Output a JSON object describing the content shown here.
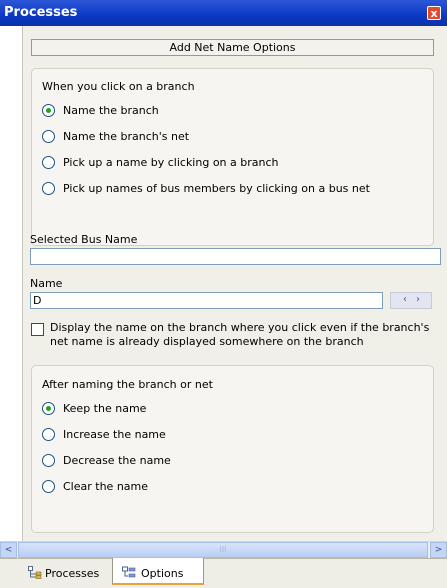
{
  "window": {
    "title": "Processes",
    "close_glyph": "x"
  },
  "options_header": "Add Net Name Options",
  "click_group": {
    "title": "When you click on a branch",
    "options": [
      {
        "label": "Name the branch",
        "selected": true
      },
      {
        "label": "Name the branch's net",
        "selected": false
      },
      {
        "label": "Pick up a name by clicking on a branch",
        "selected": false
      },
      {
        "label": "Pick up names of bus members by clicking on a bus net",
        "selected": false
      }
    ]
  },
  "selected_bus": {
    "label": "Selected Bus Name",
    "value": ""
  },
  "name_field": {
    "label": "Name",
    "value": "D",
    "decrement_glyph": "‹",
    "increment_glyph": "›"
  },
  "display_checkbox": {
    "label": "Display the name on the branch where you click even if the branch's net name is already displayed somewhere on the branch",
    "checked": false
  },
  "after_group": {
    "title": "After naming the branch or net",
    "options": [
      {
        "label": "Keep the name",
        "selected": true
      },
      {
        "label": "Increase the name",
        "selected": false
      },
      {
        "label": "Decrease the name",
        "selected": false
      },
      {
        "label": "Clear the name",
        "selected": false
      }
    ]
  },
  "scrollbar": {
    "left_glyph": "<",
    "right_glyph": ">",
    "thumb_grip": "III"
  },
  "tabs": [
    {
      "label": "Processes",
      "active": false,
      "icon": "processes-icon"
    },
    {
      "label": "Options",
      "active": true,
      "icon": "options-icon"
    }
  ],
  "colors": {
    "title_bar": "#0b39c4",
    "radio_selected": "#21a121",
    "active_tab_accent": "#e6a33a"
  }
}
